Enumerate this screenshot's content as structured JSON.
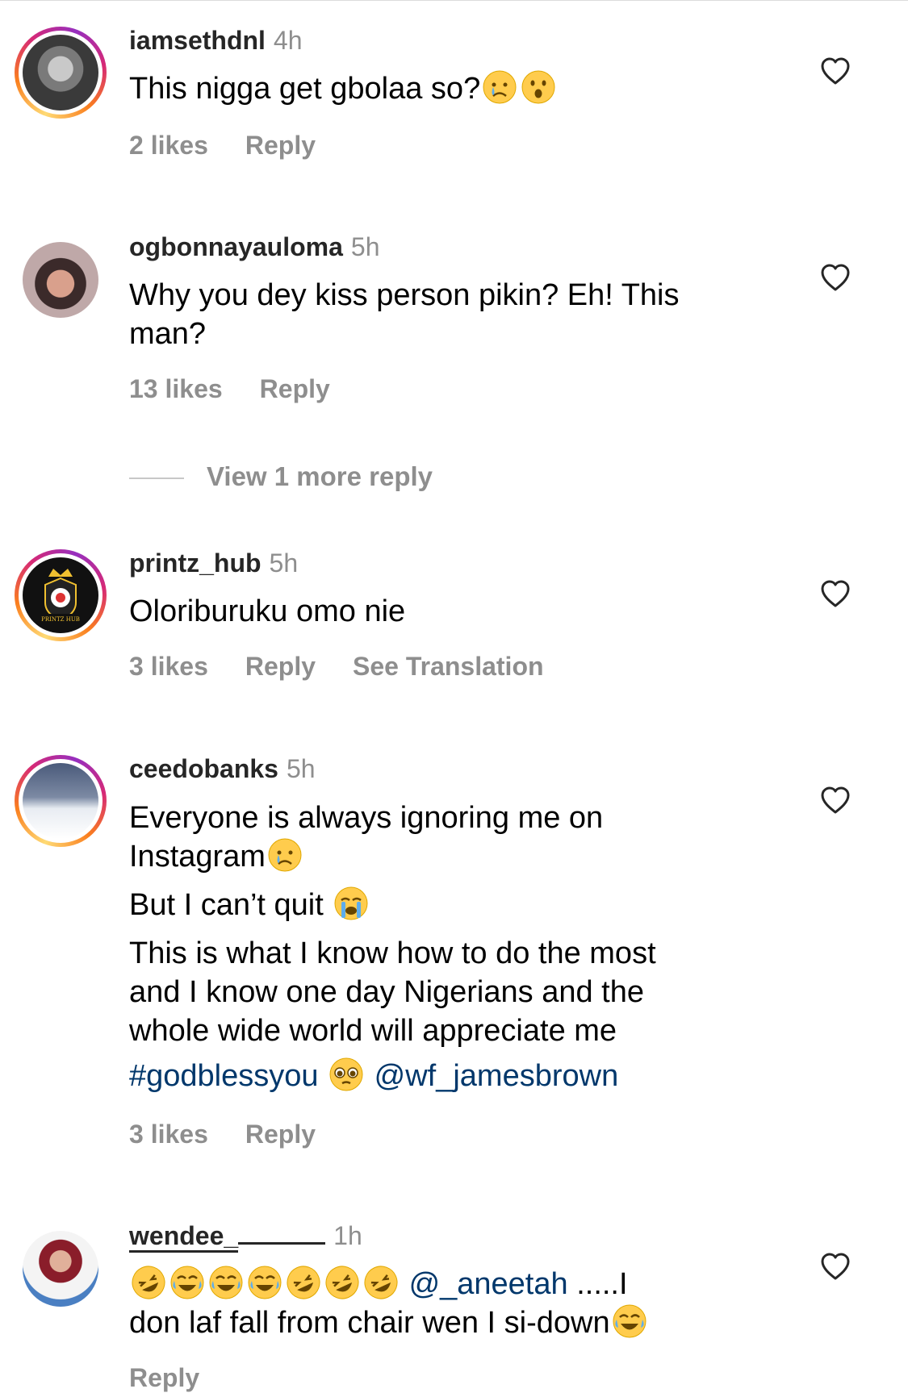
{
  "comments": [
    {
      "username": "iamsethdnl",
      "time": "4h",
      "text": "This nigga get gbolaa so?",
      "likes": "2 likes",
      "reply": "Reply"
    },
    {
      "username": "ogbonnayauloma",
      "time": "5h",
      "text_line1": "Why you dey kiss person pikin? Eh! This",
      "text_line2": "man?",
      "likes": "13 likes",
      "reply": "Reply",
      "view_more": "View 1 more reply"
    },
    {
      "username": "printz_hub",
      "time": "5h",
      "text": "Oloriburuku omo nie",
      "likes": "3 likes",
      "reply": "Reply",
      "translate": "See Translation",
      "avatar_text": "PRINTZ HUB"
    },
    {
      "username": "ceedobanks",
      "time": "5h",
      "line1": "Everyone is always ignoring me on",
      "line2": "Instagram",
      "line3": " But I can’t quit ",
      "line4": " This is what I know how to do the most",
      "line5": "and I know one day Nigerians and the",
      "line6": "whole wide world will appreciate me",
      "hashtag": "#godblessyou",
      "mention": "@wf_jamesbrown",
      "likes": "3 likes",
      "reply": "Reply"
    },
    {
      "username": "wendee_",
      "time": "1h",
      "mention": "@_aneetah",
      "line1_tail": " .....I",
      "line2": "don laf fall from chair wen I si-down",
      "reply": "Reply"
    }
  ],
  "colors": {
    "secondary_text": "#8e8e8e",
    "link": "#00376b",
    "story_ring": "#d62976"
  }
}
